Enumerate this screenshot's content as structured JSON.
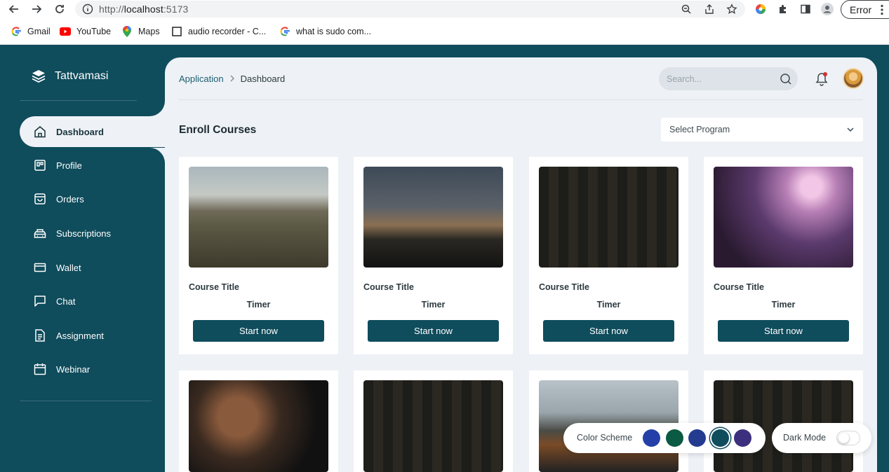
{
  "browser": {
    "url_prefix": "http://",
    "url_host": "localhost",
    "url_rest": ":5173",
    "error_label": "Error",
    "bookmarks": [
      {
        "label": "Gmail"
      },
      {
        "label": "YouTube"
      },
      {
        "label": "Maps"
      },
      {
        "label": "audio recorder - C..."
      },
      {
        "label": "what is sudo com..."
      }
    ]
  },
  "brand": {
    "name": "Tattvamasi"
  },
  "sidebar": {
    "items": [
      {
        "label": "Dashboard",
        "icon": "home-icon",
        "active": true
      },
      {
        "label": "Profile",
        "icon": "profile-icon"
      },
      {
        "label": "Orders",
        "icon": "bag-icon"
      },
      {
        "label": "Subscriptions",
        "icon": "subscription-icon"
      },
      {
        "label": "Wallet",
        "icon": "wallet-icon"
      },
      {
        "label": "Chat",
        "icon": "chat-icon"
      },
      {
        "label": "Assignment",
        "icon": "document-icon"
      },
      {
        "label": "Webinar",
        "icon": "calendar-icon"
      }
    ]
  },
  "header": {
    "breadcrumb": {
      "parent": "Application",
      "current": "Dashboard"
    },
    "search_placeholder": "Search..."
  },
  "main": {
    "section_title": "Enroll Courses",
    "select_program_placeholder": "Select Program",
    "cards": [
      {
        "title": "Course Title",
        "timer": "Timer",
        "button": "Start now",
        "image": "train"
      },
      {
        "title": "Course Title",
        "timer": "Timer",
        "button": "Start now",
        "image": "pagoda"
      },
      {
        "title": "Course Title",
        "timer": "Timer",
        "button": "Start now",
        "image": "lantern"
      },
      {
        "title": "Course Title",
        "timer": "Timer",
        "button": "Start now",
        "image": "concert"
      },
      {
        "image": "party"
      },
      {
        "image": "lantern"
      },
      {
        "image": "car"
      },
      {
        "image": "lantern"
      }
    ]
  },
  "settings": {
    "color_scheme_label": "Color Scheme",
    "colors": [
      "#2440a8",
      "#0b5a43",
      "#243c8f",
      "#0f4c5c",
      "#3b2f7e"
    ],
    "selected_color": "#0f4c5c",
    "dark_mode_label": "Dark Mode",
    "dark_mode_enabled": false
  },
  "theme": {
    "primary": "#0f4c5c",
    "background": "#eef2f6"
  }
}
